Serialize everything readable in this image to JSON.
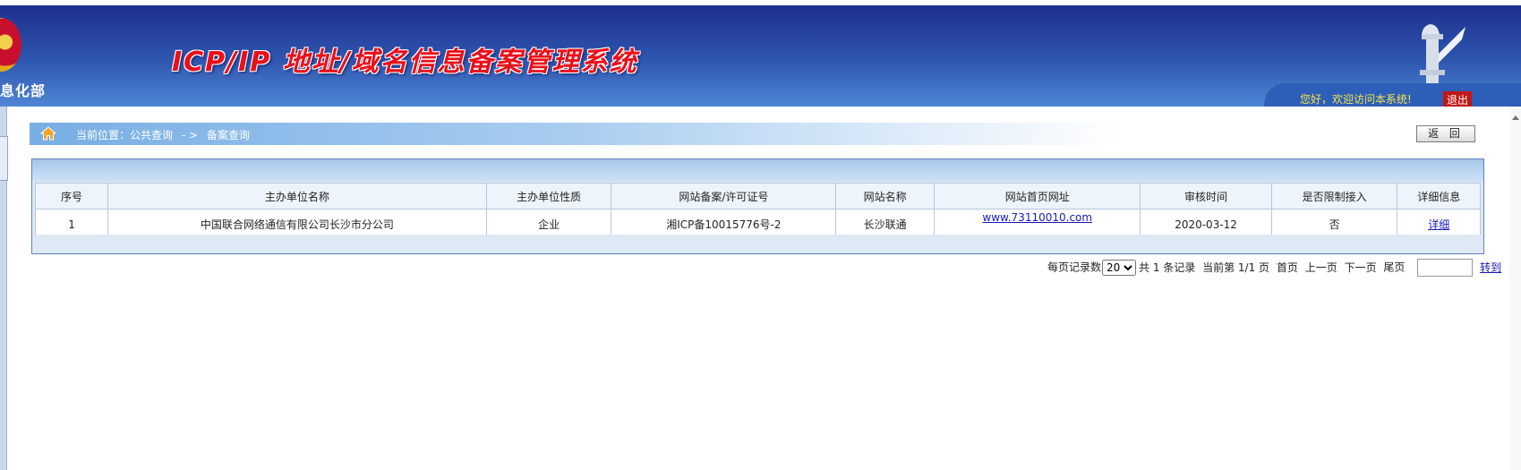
{
  "header": {
    "ministry": "息化部",
    "title": "ICP/IP 地址/域名信息备案管理系统",
    "welcome": "您好，欢迎访问本系统!",
    "logout": "退出"
  },
  "breadcrumb": {
    "current_position": "当前位置：公共查询",
    "separator": "- >",
    "page": "备案查询"
  },
  "back_button": "返 回",
  "table": {
    "columns": [
      "序号",
      "主办单位名称",
      "主办单位性质",
      "网站备案/许可证号",
      "网站名称",
      "网站首页网址",
      "审核时间",
      "是否限制接入",
      "详细信息"
    ],
    "rows": [
      {
        "index": "1",
        "org": "中国联合网络通信有限公司长沙市分公司",
        "nature": "企业",
        "license": "湘ICP备10015776号-2",
        "site_name": "长沙联通",
        "url": "www.73110010.com",
        "date": "2020-03-12",
        "restricted": "否",
        "detail": "详细"
      }
    ]
  },
  "pager": {
    "per_page_label": "每页记录数",
    "per_page_value": "20",
    "total": "共 1 条记录",
    "current": "当前第 1/1 页",
    "first": "首页",
    "prev": "上一页",
    "next": "下一页",
    "last": "尾页",
    "goto": "转到"
  },
  "colors": {
    "header_top": "#1d2f8c",
    "header_bottom": "#4f86d4",
    "title_red": "#e8101a",
    "welcome_yellow": "#f5e44a",
    "link": "#1a1ab8"
  },
  "icons": {
    "home": "home-icon",
    "emblem": "national-emblem",
    "pillar": "huabiao-pillar"
  }
}
